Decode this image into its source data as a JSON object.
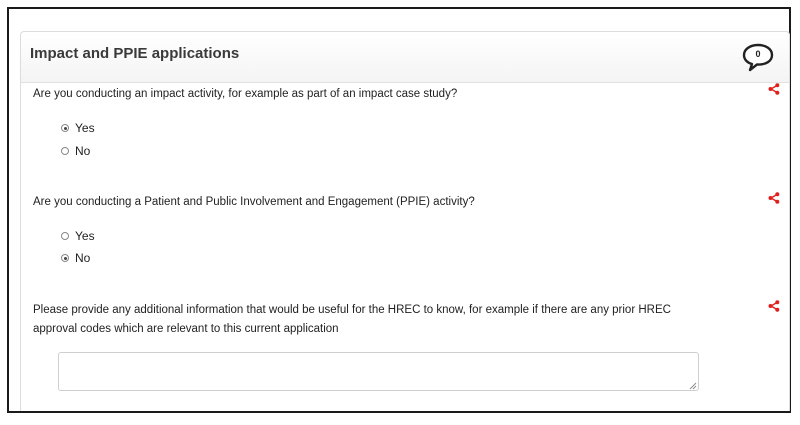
{
  "section": {
    "title": "Impact and PPIE applications",
    "comment_count": "0"
  },
  "questions": [
    {
      "text": "Are you conducting an impact activity, for example as part of an impact case study?",
      "options": [
        {
          "label": "Yes",
          "checked": true
        },
        {
          "label": "No",
          "checked": false
        }
      ]
    },
    {
      "text": "Are you conducting a Patient and Public Involvement and Engagement (PPIE) activity?",
      "options": [
        {
          "label": "Yes",
          "checked": false
        },
        {
          "label": "No",
          "checked": true
        }
      ]
    },
    {
      "text_line1": "Please provide any additional information that would be useful for the HREC to know, for example if there are any prior HREC",
      "text_line2": "approval codes which are relevant to this current application",
      "value": "",
      "placeholder": ""
    }
  ],
  "icons": {
    "comment": "speech-bubble-icon",
    "share": "share-icon"
  },
  "colors": {
    "share_icon": "#e0201b",
    "title_text": "#3a3a3a",
    "border": "#1a1a1a"
  }
}
